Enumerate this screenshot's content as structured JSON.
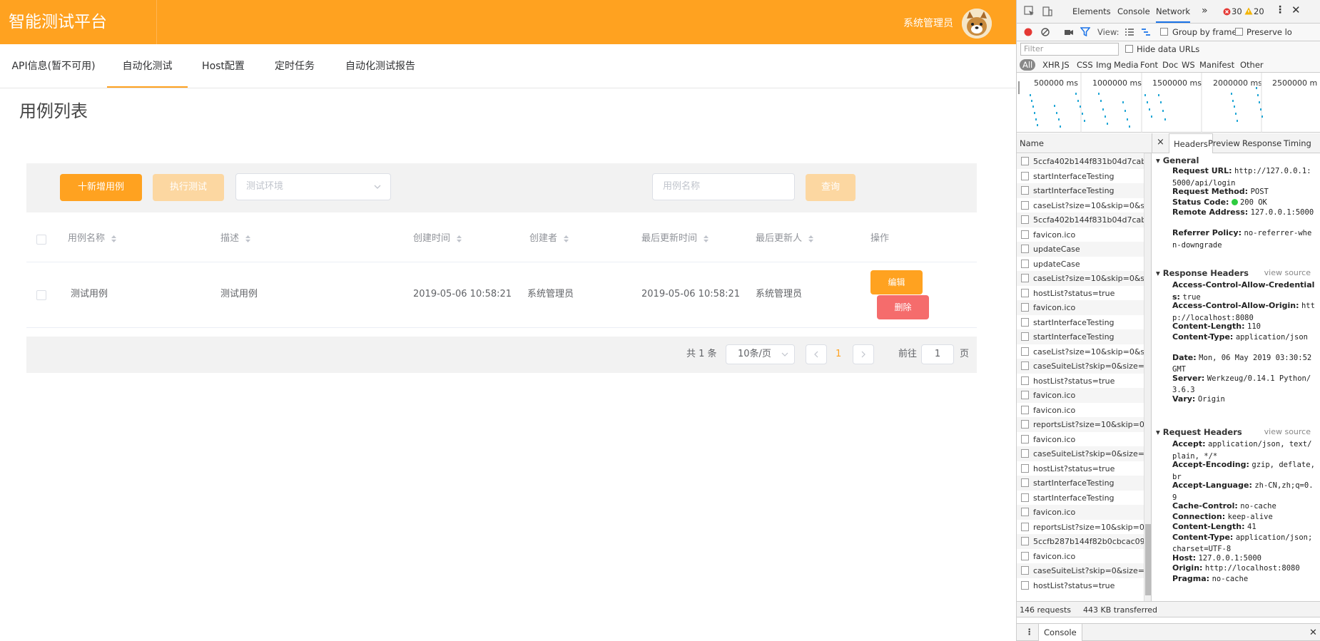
{
  "app": {
    "brand": "智能测试平台",
    "user": "系统管理员",
    "nav": [
      "API信息(暂不可用)",
      "自动化测试",
      "Host配置",
      "定时任务",
      "自动化测试报告"
    ],
    "active_tab": "自动化测试",
    "page_title": "用例列表",
    "toolbar": {
      "add_label": "十新增用例",
      "run_label": "执行测试",
      "env_placeholder": "测试环境",
      "search_placeholder": "用例名称",
      "query_label": "查询"
    },
    "table": {
      "headers": [
        "用例名称",
        "描述",
        "创建时间",
        "创建者",
        "最后更新时间",
        "最后更新人",
        "操作"
      ],
      "rows": [
        {
          "name": "测试用例",
          "desc": "测试用例",
          "created": "2019-05-06 10:58:21",
          "creator": "系统管理员",
          "updated": "2019-05-06 10:58:21",
          "updater": "系统管理员"
        }
      ],
      "edit_label": "编辑",
      "delete_label": "删除"
    },
    "pager": {
      "total": "共 1 条",
      "page_size": "10条/页",
      "current": "1",
      "goto_prefix": "前往",
      "goto_value": "1",
      "goto_suffix": "页"
    },
    "colors": {
      "primary": "#ffa220",
      "danger": "#f56c6c",
      "disabled": "#fcd7a1"
    }
  },
  "devtools": {
    "tabs": [
      "Elements",
      "Console",
      "Network"
    ],
    "active_tab": "Network",
    "errors": "30",
    "warnings": "20",
    "view_label": "View:",
    "group_by_frame": "Group by frame",
    "preserve_log": "Preserve lo",
    "filter_placeholder": "Filter",
    "hide_data_urls": "Hide data URLs",
    "type_filters": [
      "All",
      "XHR",
      "JS",
      "CSS",
      "Img",
      "Media",
      "Font",
      "Doc",
      "WS",
      "Manifest",
      "Other"
    ],
    "timeline": [
      "500000 ms",
      "1000000 ms",
      "1500000 ms",
      "2000000 ms",
      "2500000 m"
    ],
    "name_header": "Name",
    "detail_tabs": [
      "Headers",
      "Preview",
      "Response",
      "Timing"
    ],
    "requests": [
      "5ccfa402b144f831b04d7cab",
      "startInterfaceTesting",
      "startInterfaceTesting",
      "caseList?size=10&skip=0&s",
      "5ccfa402b144f831b04d7cab",
      "favicon.ico",
      "updateCase",
      "updateCase",
      "caseList?size=10&skip=0&s",
      "hostList?status=true",
      "favicon.ico",
      "startInterfaceTesting",
      "startInterfaceTesting",
      "caseList?size=10&skip=0&s",
      "caseSuiteList?skip=0&size=:",
      "hostList?status=true",
      "favicon.ico",
      "favicon.ico",
      "reportsList?size=10&skip=0",
      "favicon.ico",
      "caseSuiteList?skip=0&size=:",
      "hostList?status=true",
      "startInterfaceTesting",
      "startInterfaceTesting",
      "favicon.ico",
      "reportsList?size=10&skip=0",
      "5ccfb287b144f82b0cbcac09",
      "favicon.ico",
      "caseSuiteList?skip=0&size=:",
      "hostList?status=true"
    ],
    "general_title": "General",
    "general": [
      {
        "k": "Request URL:",
        "v": "http://127.0.0.1:5000/api/login"
      },
      {
        "k": "Request Method:",
        "v": "POST"
      },
      {
        "k": "Status Code:",
        "v": "200 OK"
      },
      {
        "k": "Remote Address:",
        "v": "127.0.0.1:5000"
      },
      {
        "k": "Referrer Policy:",
        "v": "no-referrer-when-downgrade"
      }
    ],
    "response_title": "Response Headers",
    "response": [
      {
        "k": "Access-Control-Allow-Credentials:",
        "v": "true"
      },
      {
        "k": "Access-Control-Allow-Origin:",
        "v": "http://localhost:8080"
      },
      {
        "k": "Content-Length:",
        "v": "110"
      },
      {
        "k": "Content-Type:",
        "v": "application/json"
      },
      {
        "k": "Date:",
        "v": "Mon, 06 May 2019 03:30:52 GMT"
      },
      {
        "k": "Server:",
        "v": "Werkzeug/0.14.1 Python/3.6.3"
      },
      {
        "k": "Vary:",
        "v": "Origin"
      }
    ],
    "request_title": "Request Headers",
    "request": [
      {
        "k": "Accept:",
        "v": "application/json, text/plain, */*"
      },
      {
        "k": "Accept-Encoding:",
        "v": "gzip, deflate, br"
      },
      {
        "k": "Accept-Language:",
        "v": "zh-CN,zh;q=0.9"
      },
      {
        "k": "Cache-Control:",
        "v": "no-cache"
      },
      {
        "k": "Connection:",
        "v": "keep-alive"
      },
      {
        "k": "Content-Length:",
        "v": "41"
      },
      {
        "k": "Content-Type:",
        "v": "application/json;charset=UTF-8"
      },
      {
        "k": "Host:",
        "v": "127.0.0.1:5000"
      },
      {
        "k": "Origin:",
        "v": "http://localhost:8080"
      },
      {
        "k": "Pragma:",
        "v": "no-cache"
      }
    ],
    "view_source": "view source",
    "summary_requests": "146 requests",
    "summary_transferred": "443 KB transferred",
    "drawer_tab": "Console"
  }
}
